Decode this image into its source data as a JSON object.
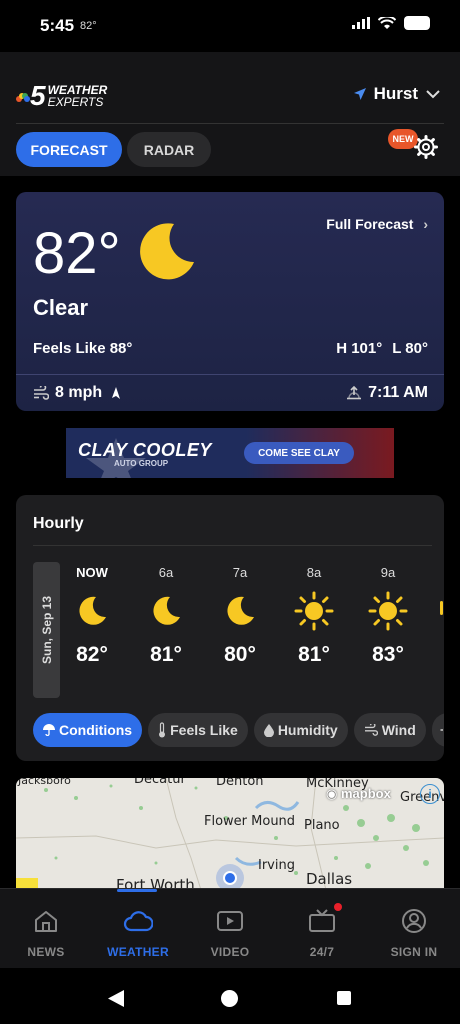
{
  "status_bar": {
    "time": "5:45",
    "temp": "82°"
  },
  "header": {
    "logo_five": "5",
    "logo_line1": "WEATHER",
    "logo_line2": "EXPERTS",
    "location": "Hurst",
    "tabs": [
      {
        "label": "FORECAST",
        "active": true
      },
      {
        "label": "RADAR",
        "active": false
      }
    ],
    "new_badge": "NEW"
  },
  "current": {
    "temperature": "82°",
    "condition": "Clear",
    "full_forecast_link": "Full Forecast",
    "feels_like": "Feels Like 88°",
    "high": "H 101°",
    "low": "L 80°",
    "wind": "8 mph",
    "sunrise": "7:11 AM"
  },
  "ad": {
    "brand": "CLAY COOLEY",
    "sub": "AUTO GROUP",
    "cta": "COME SEE CLAY"
  },
  "hourly": {
    "title": "Hourly",
    "date": "Sun, Sep 13",
    "hours": [
      {
        "label": "NOW",
        "icon": "moon-icon",
        "temp": "82°"
      },
      {
        "label": "6a",
        "icon": "moon-icon",
        "temp": "81°"
      },
      {
        "label": "7a",
        "icon": "moon-icon",
        "temp": "80°"
      },
      {
        "label": "8a",
        "icon": "sun-icon",
        "temp": "81°"
      },
      {
        "label": "9a",
        "icon": "sun-icon",
        "temp": "83°"
      }
    ],
    "pills": [
      {
        "label": "Conditions",
        "icon": "umbrella-icon",
        "active": true
      },
      {
        "label": "Feels Like",
        "icon": "thermometer-icon",
        "active": false
      },
      {
        "label": "Humidity",
        "icon": "droplet-icon",
        "active": false
      },
      {
        "label": "Wind",
        "icon": "wind-icon",
        "active": false
      }
    ]
  },
  "map": {
    "labels": [
      "Jacksboro",
      "Decatur",
      "Denton",
      "McKinney",
      "Greenv",
      "Flower Mound",
      "Plano",
      "Irving",
      "Fort Worth",
      "Dallas"
    ],
    "attribution": "mapbox"
  },
  "bottom_nav": [
    {
      "label": "NEWS",
      "icon": "home-icon",
      "active": false
    },
    {
      "label": "WEATHER",
      "icon": "cloud-icon",
      "active": true
    },
    {
      "label": "VIDEO",
      "icon": "play-icon",
      "active": false
    },
    {
      "label": "24/7",
      "icon": "tv-icon",
      "active": false
    },
    {
      "label": "SIGN IN",
      "icon": "user-icon",
      "active": false
    }
  ],
  "colors": {
    "accent": "#2e6ee8",
    "moon": "#f7c823",
    "sun": "#f7c823",
    "badge": "#e8562a"
  }
}
